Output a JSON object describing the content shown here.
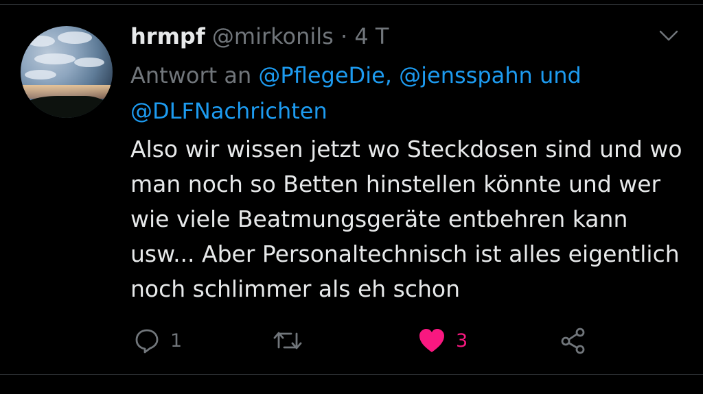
{
  "tweet": {
    "name": "hrmpf",
    "handle": "@mirkonils",
    "separator": "·",
    "time": "4 T",
    "reply_prefix": "Antwort an",
    "mention_1": "@PflegeDie,",
    "mention_2": "@jensspahn",
    "mention_connector": "und",
    "mention_3": "@DLFNachrichten",
    "text": "Also wir wissen jetzt wo Steckdosen sind und wo man noch so Betten hinstellen könnte und wer wie viele Beatmungsgeräte entbehren kann usw... Aber Personaltechnisch ist alles eigentlich noch schlimmer als eh schon"
  },
  "actions": {
    "reply_count": "1",
    "retweet_count": "",
    "like_count": "3",
    "share_icon": "share-icon"
  },
  "colors": {
    "background": "#000000",
    "text": "#e7e9ea",
    "muted": "#71767b",
    "link": "#1d9bf0",
    "like": "#f91880"
  }
}
